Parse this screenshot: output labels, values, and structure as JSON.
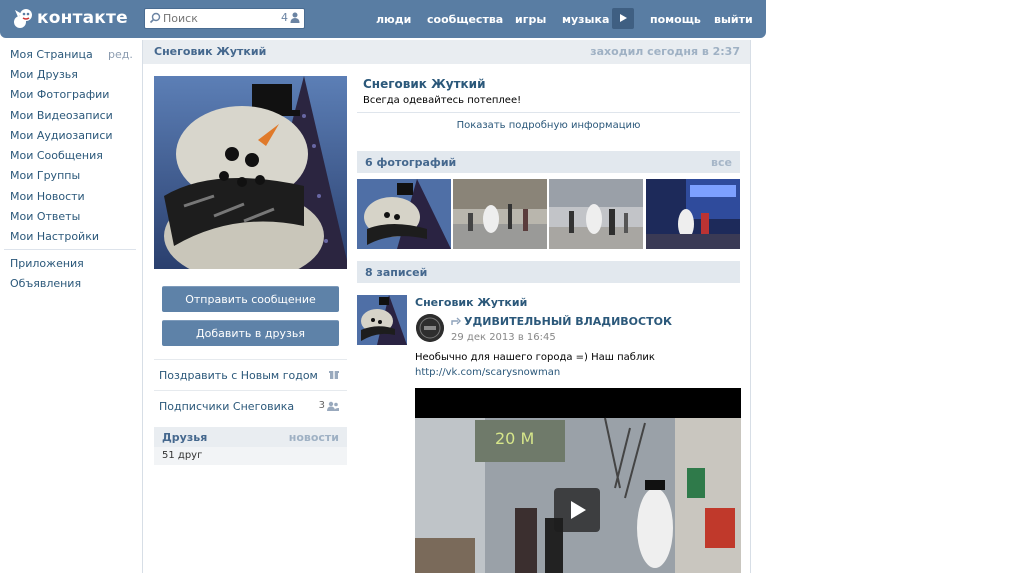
{
  "header": {
    "logo_text": "контакте",
    "search": {
      "placeholder": "Поиск",
      "count": "4"
    },
    "nav": [
      {
        "label": "люди"
      },
      {
        "label": "сообщества"
      },
      {
        "label": "игры"
      },
      {
        "label": "музыка"
      },
      {
        "label": "помощь"
      },
      {
        "label": "выйти"
      }
    ]
  },
  "sidebar": {
    "edit_label": "ред.",
    "items": [
      {
        "label": "Моя Страница"
      },
      {
        "label": "Мои Друзья"
      },
      {
        "label": "Мои Фотографии"
      },
      {
        "label": "Мои Видеозаписи"
      },
      {
        "label": "Мои Аудиозаписи"
      },
      {
        "label": "Мои Сообщения"
      },
      {
        "label": "Мои Группы"
      },
      {
        "label": "Мои Новости"
      },
      {
        "label": "Мои Ответы"
      },
      {
        "label": "Мои Настройки"
      }
    ],
    "extra": [
      {
        "label": "Приложения"
      },
      {
        "label": "Объявления"
      }
    ]
  },
  "profile": {
    "title_name": "Снеговик Жуткий",
    "online": "заходил сегодня в 2:37",
    "name": "Снеговик Жуткий",
    "status": "Всегда одевайтесь потеплее!",
    "info_link": "Показать подробную информацию",
    "send_message": "Отправить сообщение",
    "add_friend": "Добавить в друзья",
    "congratulate": "Поздравить с Новым годом",
    "subscribers_label": "Подписчики Снеговика",
    "subscribers_count": "3",
    "friends_title": "Друзья",
    "friends_news": "новости",
    "friends_count": "51 друг"
  },
  "photos": {
    "title": "6 фотографий",
    "all": "все"
  },
  "wall": {
    "title": "8 записей",
    "post": {
      "author": "Снеговик Жуткий",
      "repost_from": "УДИВИТЕЛЬНЫЙ ВЛАДИВОСТОК",
      "date": "29 дек 2013 в 16:45",
      "text": "Необычно для нашего города =) Наш паблик",
      "link": "http://vk.com/scarysnowman"
    }
  },
  "colors": {
    "header": "#597da3",
    "link": "#2b587a",
    "button": "#5e82a8"
  }
}
